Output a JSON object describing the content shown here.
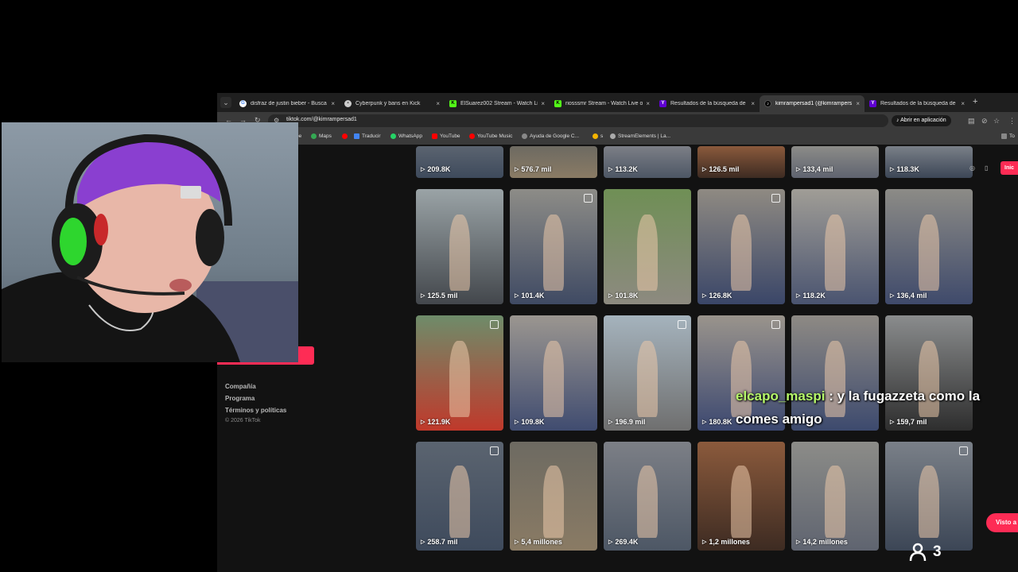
{
  "browser": {
    "tabs": [
      {
        "title": "disfraz de justin bieber - Busca",
        "favicon": "google",
        "active": false
      },
      {
        "title": "Cyberpunk y bans en Kick",
        "favicon": "page",
        "active": false
      },
      {
        "title": "ElSuarez002 Stream - Watch Li",
        "favicon": "kick",
        "active": false
      },
      {
        "title": "riosssmr Stream - Watch Live o",
        "favicon": "kick",
        "active": false
      },
      {
        "title": "Resultados de la búsqueda de",
        "favicon": "yahoo",
        "active": false
      },
      {
        "title": "kimrampersad1 (@kimrampers",
        "favicon": "tiktok",
        "active": true
      },
      {
        "title": "Resultados de la búsqueda de",
        "favicon": "yahoo",
        "active": false
      }
    ],
    "new_tab": "+",
    "close_glyph": "×",
    "url": "tiktok.com/@kimrampersad1",
    "open_in_app": "Abrir en aplicación",
    "bookmarks": [
      "Maps",
      "Traducir",
      "WhatsApp",
      "YouTube",
      "YouTube Music",
      "Ayuda de Google C...",
      "s",
      "StreamElements | La..."
    ],
    "bookmarks_cut_left": "be",
    "bookmarks_cut_right": "To"
  },
  "sidebar": {
    "links": [
      "Compañía",
      "Programa",
      "Términos y políticas"
    ],
    "copyright": "© 2026 TikTok"
  },
  "grid": {
    "rows": [
      {
        "views": [
          "209.8K",
          "576.7 mil",
          "113.2K",
          "126.5 mil",
          "133,4 mil",
          "118.3K"
        ]
      },
      {
        "views": [
          "125.5 mil",
          "101.4K",
          "101.8K",
          "126.8K",
          "118.2K",
          "136,4 mil"
        ]
      },
      {
        "views": [
          "121.9K",
          "109.8K",
          "196.9 mil",
          "180.8K",
          "",
          "159,7 mil"
        ]
      },
      {
        "views": [
          "258.7 mil",
          "5,4 millones",
          "269.4K",
          "1,2 millones",
          "14,2 millones",
          ""
        ]
      }
    ]
  },
  "overlay": {
    "chat_user": "elcapo_maspi",
    "chat_message_line1": ": y la fugazzeta como la",
    "chat_message_line2": "comes amigo",
    "viewer_count": "3",
    "visto_button": "Visto a",
    "top_button": "Inic"
  },
  "colors": {
    "tiktok_red": "#fe2c55",
    "chat_user": "#b6f86a"
  }
}
